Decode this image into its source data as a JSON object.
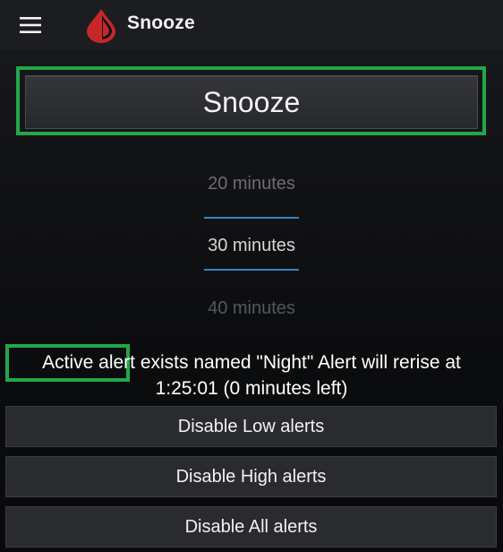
{
  "toolbar": {
    "title": "Snooze",
    "menu_icon": "menu-icon",
    "logo_icon": "blood-drop-logo",
    "logo_color": "#c62828"
  },
  "snooze_button": {
    "label": "Snooze"
  },
  "picker": {
    "options": [
      "20 minutes",
      "30 minutes",
      "40 minutes"
    ],
    "selected": "30 minutes",
    "accent_color": "#2f86c6"
  },
  "alert_status": {
    "highlighted": "Active alert",
    "rest_line1": " exists named \"Night\" Alert will rerise at",
    "line2": "1:25:01 (0 minutes left)"
  },
  "actions": {
    "disable_low": "Disable Low alerts",
    "disable_high": "Disable High alerts",
    "disable_all": "Disable All alerts"
  },
  "highlight_color": "#22a74a"
}
